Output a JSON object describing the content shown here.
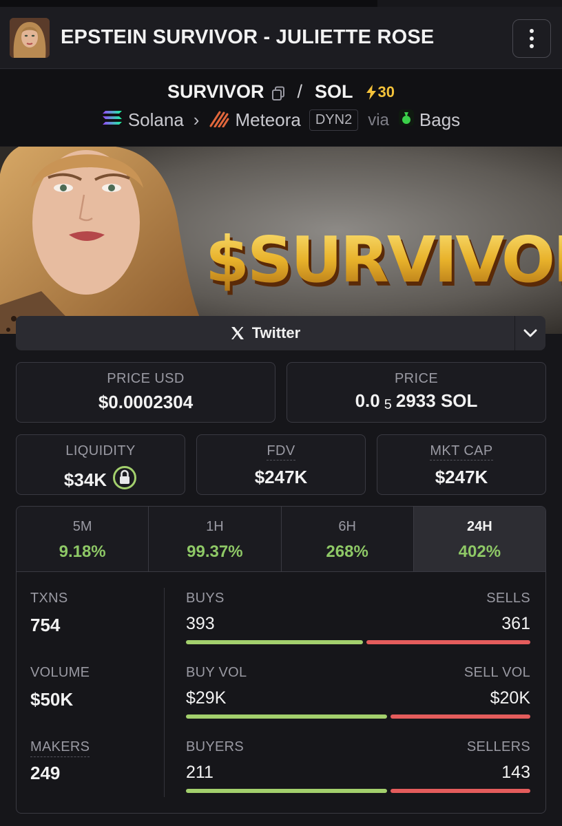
{
  "header": {
    "title": "EPSTEIN SURVIVOR - JULIETTE ROSE"
  },
  "pair": {
    "base": "SURVIVOR",
    "separator": "/",
    "quote": "SOL",
    "boost": "30"
  },
  "route": {
    "chain": "Solana",
    "dex": "Meteora",
    "pool_type": "DYN2",
    "via": "via",
    "launchpad": "Bags"
  },
  "banner": {
    "headline": "$SURVIVOR"
  },
  "links": {
    "twitter_label": "Twitter"
  },
  "price": {
    "usd_label": "PRICE USD",
    "usd_value": "$0.0002304",
    "native_label": "PRICE",
    "native_prefix": "0.0",
    "native_zero_count": "5",
    "native_digits": "2933 SOL"
  },
  "metrics": {
    "liquidity_label": "LIQUIDITY",
    "liquidity_value": "$34K",
    "fdv_label": "FDV",
    "fdv_value": "$247K",
    "mcap_label": "MKT CAP",
    "mcap_value": "$247K"
  },
  "timeframes": [
    {
      "label": "5M",
      "change": "9.18%"
    },
    {
      "label": "1H",
      "change": "99.37%"
    },
    {
      "label": "6H",
      "change": "268%"
    },
    {
      "label": "24H",
      "change": "402%",
      "active": true
    }
  ],
  "activity": {
    "txns_label": "TXNS",
    "txns_value": "754",
    "volume_label": "VOLUME",
    "volume_value": "$50K",
    "makers_label": "MAKERS",
    "makers_value": "249",
    "buys_label": "BUYS",
    "buys_value": "393",
    "sells_label": "SELLS",
    "sells_value": "361",
    "buy_vol_label": "BUY VOL",
    "buy_vol_value": "$29K",
    "sell_vol_label": "SELL VOL",
    "sell_vol_value": "$20K",
    "buyers_label": "BUYERS",
    "buyers_value": "211",
    "sellers_label": "SELLERS",
    "sellers_value": "143"
  },
  "ratios": {
    "buys_share": 0.52,
    "buy_vol_share": 0.59,
    "buyers_share": 0.59
  },
  "colors": {
    "positive": "#8ec866",
    "buy_bar": "#a3d06d",
    "sell_bar": "#e45c5c",
    "boost": "#f4c23a",
    "background": "#16161a"
  }
}
